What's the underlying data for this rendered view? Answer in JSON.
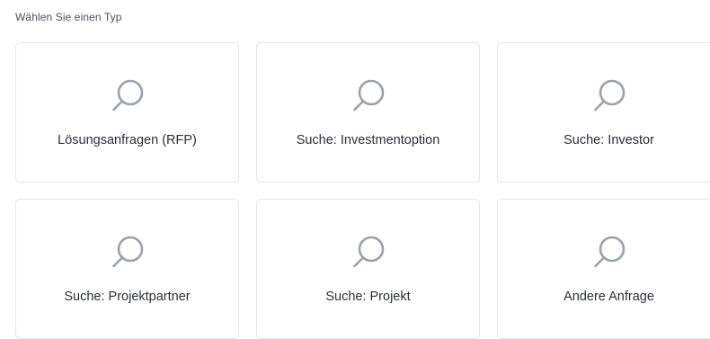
{
  "page": {
    "section_label": "Wählen Sie einen Typ"
  },
  "types": [
    {
      "label": "Lösungsanfragen (RFP)",
      "icon": "search-icon"
    },
    {
      "label": "Suche: Investmentoption",
      "icon": "search-icon"
    },
    {
      "label": "Suche: Investor",
      "icon": "search-icon"
    },
    {
      "label": "Suche: Projektpartner",
      "icon": "search-icon"
    },
    {
      "label": "Suche: Projekt",
      "icon": "search-icon"
    },
    {
      "label": "Andere Anfrage",
      "icon": "search-icon"
    }
  ],
  "colors": {
    "icon_stroke": "#9aa1ab",
    "card_border": "#e3e6ea",
    "text": "#2b2f36"
  }
}
